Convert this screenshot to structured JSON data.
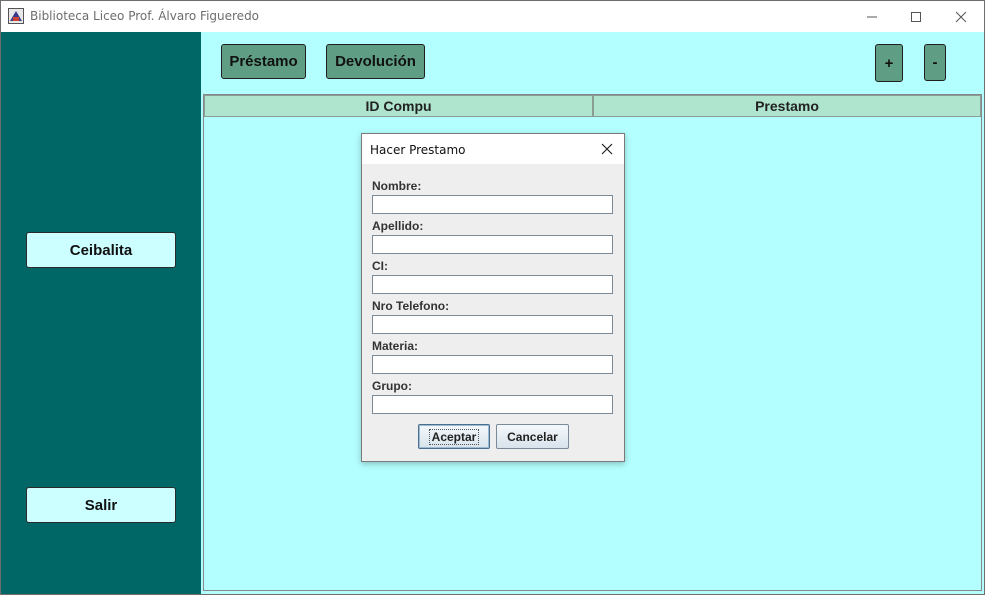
{
  "window": {
    "title": "Biblioteca Liceo Prof. Álvaro Figueredo",
    "minimize_glyph": "—",
    "maximize_glyph": "☐",
    "close_glyph": "✕"
  },
  "sidebar": {
    "ceibalita_label": "Ceibalita",
    "salir_label": "Salir"
  },
  "toolbar": {
    "prestamo_label": "Préstamo",
    "devolucion_label": "Devolución",
    "plus_label": "+",
    "minus_label": "-"
  },
  "table": {
    "columns": [
      "ID Compu",
      "Prestamo"
    ],
    "rows": []
  },
  "dialog": {
    "title": "Hacer Prestamo",
    "fields": [
      {
        "label": "Nombre:",
        "value": ""
      },
      {
        "label": "Apellido:",
        "value": ""
      },
      {
        "label": "CI:",
        "value": ""
      },
      {
        "label": "Nro Telefono:",
        "value": ""
      },
      {
        "label": "Materia:",
        "value": ""
      },
      {
        "label": "Grupo:",
        "value": ""
      }
    ],
    "accept_label": "Aceptar",
    "cancel_label": "Cancelar"
  },
  "colors": {
    "sidebar_bg": "#006666",
    "content_bg": "#b3ffff",
    "toolbar_button": "#5f9e84",
    "side_button": "#ccffff",
    "table_header": "#afe5cf"
  },
  "icons": {
    "app": "library-app-icon",
    "dialog_close": "close-icon"
  }
}
